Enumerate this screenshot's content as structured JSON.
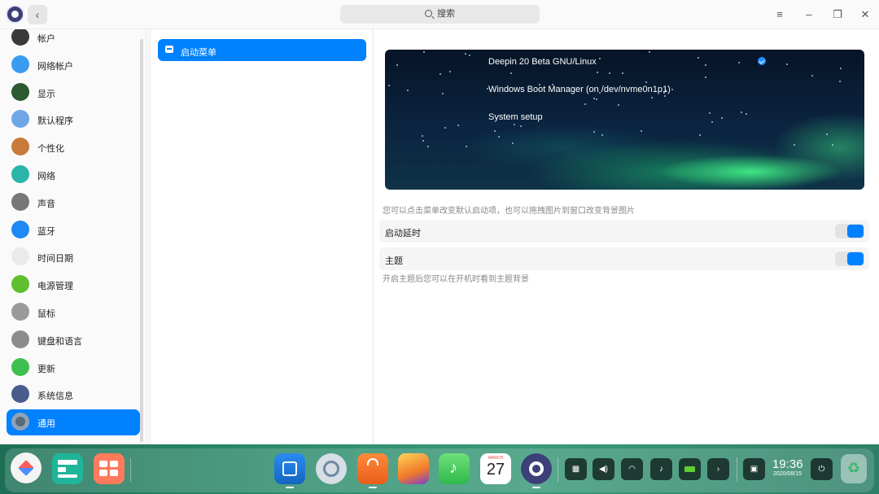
{
  "titlebar": {
    "back_symbol": "‹",
    "search_placeholder": "搜索",
    "menu_symbol": "≡",
    "minimize_symbol": "–",
    "restore_symbol": "❐",
    "close_symbol": "✕"
  },
  "sidebar": {
    "items": [
      {
        "label": "帐户",
        "icon": "account-icon",
        "color": "#3a3a3a"
      },
      {
        "label": "网络帐户",
        "icon": "cloud-icon",
        "color": "#3a9cf0"
      },
      {
        "label": "显示",
        "icon": "display-icon",
        "color": "#2d5a2f"
      },
      {
        "label": "默认程序",
        "icon": "default-apps-icon",
        "color": "#6fa6e8"
      },
      {
        "label": "个性化",
        "icon": "personalization-icon",
        "color": "#c77a3a"
      },
      {
        "label": "网络",
        "icon": "network-icon",
        "color": "#2bb5a8"
      },
      {
        "label": "声音",
        "icon": "sound-icon",
        "color": "#777777"
      },
      {
        "label": "蓝牙",
        "icon": "bluetooth-icon",
        "color": "#1e88f5"
      },
      {
        "label": "时间日期",
        "icon": "clock-icon",
        "color": "#eaeaea"
      },
      {
        "label": "电源管理",
        "icon": "battery-icon",
        "color": "#5fbf2e"
      },
      {
        "label": "鼠标",
        "icon": "mouse-icon",
        "color": "#9a9a9a"
      },
      {
        "label": "键盘和语言",
        "icon": "keyboard-icon",
        "color": "#8c8c8c"
      },
      {
        "label": "更新",
        "icon": "update-icon",
        "color": "#3fbf4f"
      },
      {
        "label": "系统信息",
        "icon": "system-info-icon",
        "color": "#4a5c8c"
      },
      {
        "label": "通用",
        "icon": "general-icon",
        "color": "#5a6a7a",
        "active": true
      }
    ]
  },
  "middle": {
    "selected_label": "启动菜单"
  },
  "boot_menu": {
    "entries": [
      "Deepin 20 Beta GNU/Linux",
      "Windows Boot Manager (on /dev/nvme0n1p1)",
      "System setup"
    ],
    "hint": "您可以点击菜单改变默认启动项，也可以拖拽图片到窗口改变背景图片",
    "boot_delay_label": "启动延时",
    "boot_delay_on": true,
    "theme_label": "主题",
    "theme_on": true,
    "theme_hint": "开启主题后您可以在开机时看到主题背景"
  },
  "dock": {
    "apps": [
      {
        "name": "launcher-icon",
        "color": "#ffffff"
      },
      {
        "name": "multitasking-icon",
        "color": "#1fb59a"
      },
      {
        "name": "workspace-icon",
        "color": "#ff7b5c"
      },
      {
        "name": "app-store-icon",
        "color": "#2a8cf0"
      },
      {
        "name": "browser-icon",
        "color": "#9fb3c6"
      },
      {
        "name": "shopping-bag-icon",
        "color": "#ff7a2a"
      },
      {
        "name": "image-viewer-icon",
        "color": "#f2a33a"
      },
      {
        "name": "music-icon",
        "color": "#4cd964"
      },
      {
        "name": "calendar-icon",
        "color": "#ffffff"
      },
      {
        "name": "control-center-icon",
        "color": "#3c3f78"
      }
    ],
    "calendar_month": "MARCH",
    "calendar_day": "27",
    "tray": {
      "keyboard_symbol": "▦",
      "volume_symbol": "◀)",
      "wifi_symbol": "◠",
      "notification_symbol": "♪",
      "battery_symbol": "▬",
      "expand_symbol": "›",
      "ime_symbol": "▣",
      "power_symbol": "⏻"
    },
    "time": "19:36",
    "date": "2020/08/15",
    "trash_symbol": "♻"
  }
}
